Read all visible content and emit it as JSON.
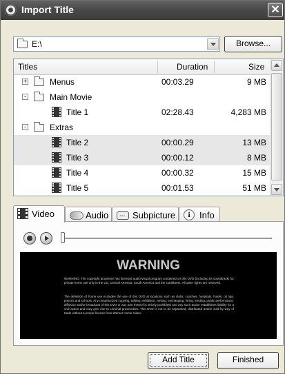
{
  "window": {
    "title": "Import Title"
  },
  "path": {
    "value": "E:\\"
  },
  "buttons": {
    "browse": "Browse...",
    "add_title": "Add Title",
    "finished": "Finished"
  },
  "list": {
    "columns": {
      "titles": "Titles",
      "duration": "Duration",
      "size": "Size"
    },
    "rows": [
      {
        "label": "Menus",
        "duration": "00:03.29",
        "size": "9 MB",
        "type": "folder",
        "expander": "+"
      },
      {
        "label": "Main Movie",
        "duration": "",
        "size": "",
        "type": "folder",
        "expander": "-"
      },
      {
        "label": "Title 1",
        "duration": "02:28.43",
        "size": "4,283 MB",
        "type": "title"
      },
      {
        "label": "Extras",
        "duration": "",
        "size": "",
        "type": "folder",
        "expander": "-"
      },
      {
        "label": "Title 2",
        "duration": "00:00.29",
        "size": "13 MB",
        "type": "title",
        "selected": true
      },
      {
        "label": "Title 3",
        "duration": "00:00.12",
        "size": "8 MB",
        "type": "title",
        "selected": true
      },
      {
        "label": "Title 4",
        "duration": "00:00.32",
        "size": "15 MB",
        "type": "title"
      },
      {
        "label": "Title 5",
        "duration": "00:01.53",
        "size": "51 MB",
        "type": "title"
      }
    ]
  },
  "tabs": {
    "video": "Video",
    "audio": "Audio",
    "subpicture": "Subpicture",
    "info": "Info"
  },
  "preview": {
    "warning_title": "WARNING",
    "paragraph1": "WARNING: The copyright proprietor has licensed audio-visual program contained on this DVD (including its soundtrack) for private home use only in the US, Central America, South America and the Caribbean. All other rights are reserved.",
    "paragraph2": "The definition of home use excludes the use of this DVD at locations such as clubs, coaches, hospitals, hotels, oil rigs, prisons and schools. Any unauthorized copying, editing, exhibition, renting, exchanging, hiring, lending, public performance, diffusion and/or broadcast of this DVD or any part thereof is strictly prohibited and any such action establishes liability for a civil action and may give rise to criminal prosecution. This DVD is not to be separated, distributed and/or sold by way of trade without a proper license from Warner Home Video."
  }
}
